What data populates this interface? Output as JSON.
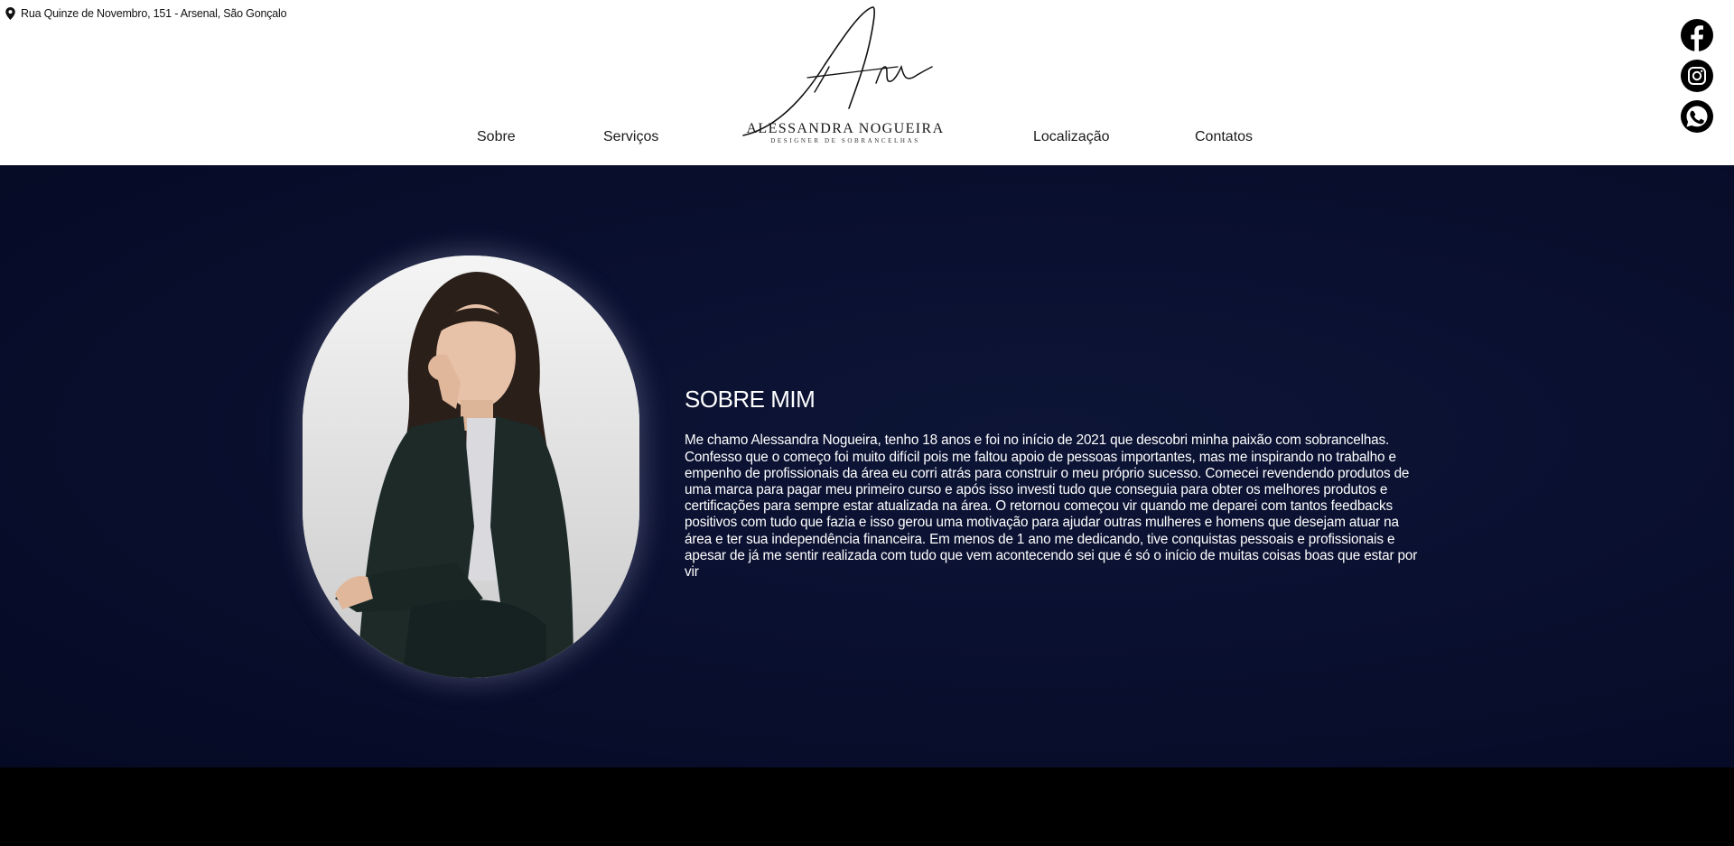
{
  "header": {
    "address": "Rua Quinze de Novembro, 151 - Arsenal, São Gonçalo",
    "address_icon": "map-pin-icon",
    "nav": [
      "Sobre",
      "Serviços",
      "Localização",
      "Contatos"
    ],
    "logo": {
      "name": "ALESSANDRA NOGUEIRA",
      "subtitle": "DESIGNER DE SOBRANCELHAS",
      "monogram": "An"
    },
    "social_icons": [
      "facebook-icon",
      "instagram-icon",
      "whatsapp-icon"
    ]
  },
  "about": {
    "title": "SOBRE MIM",
    "text": "Me chamo Alessandra Nogueira, tenho 18 anos e foi no início de 2021 que descobri minha paixão com sobrancelhas. Confesso que o começo foi muito difícil pois me faltou apoio de pessoas importantes, mas me inspirando no trabalho e empenho de profissionais da área eu corri atrás para construir o meu próprio sucesso. Comecei revendendo produtos de uma marca para pagar meu primeiro curso e após isso investi tudo que conseguia para obter os melhores produtos e certificações para sempre estar atualizada na área. O retornou começou vir quando me deparei com tantos feedbacks positivos com tudo que fazia e isso gerou uma motivação para ajudar outras mulheres e homens que desejam atuar na área e ter sua independência financeira. Em menos de 1 ano me dedicando, tive conquistas pessoais e profissionais e apesar de já me sentir realizada com tudo que vem acontecendo sei que é só o início de muitas coisas boas que estar por vir"
  },
  "colors": {
    "hero_bg": "#0a1030",
    "header_bg": "#ffffff",
    "text_light": "#ffffff",
    "text_dark": "#1a1a1a"
  }
}
